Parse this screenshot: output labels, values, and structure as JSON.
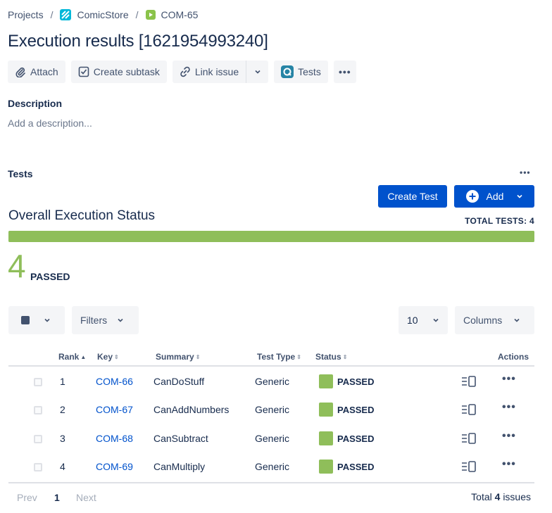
{
  "breadcrumb": {
    "projects": "Projects",
    "project": "ComicStore",
    "issue": "COM-65"
  },
  "title": "Execution results [1621954993240]",
  "toolbar": {
    "attach": "Attach",
    "create_subtask": "Create subtask",
    "link_issue": "Link issue",
    "tests": "Tests"
  },
  "description": {
    "label": "Description",
    "placeholder": "Add a description..."
  },
  "tests_section": {
    "label": "Tests",
    "create_test": "Create Test",
    "add": "Add",
    "overall_title": "Overall Execution Status",
    "total_tests": "TOTAL TESTS: 4",
    "passed_count": "4",
    "passed_label": "PASSED",
    "passed_fraction": 1.0
  },
  "controls": {
    "filters": "Filters",
    "page_size": "10",
    "columns": "Columns"
  },
  "table": {
    "headers": {
      "rank": "Rank",
      "key": "Key",
      "summary": "Summary",
      "test_type": "Test Type",
      "status": "Status",
      "actions": "Actions"
    },
    "rows": [
      {
        "rank": "1",
        "key": "COM-66",
        "summary": "CanDoStuff",
        "test_type": "Generic",
        "status": "PASSED"
      },
      {
        "rank": "2",
        "key": "COM-67",
        "summary": "CanAddNumbers",
        "test_type": "Generic",
        "status": "PASSED"
      },
      {
        "rank": "3",
        "key": "COM-68",
        "summary": "CanSubtract",
        "test_type": "Generic",
        "status": "PASSED"
      },
      {
        "rank": "4",
        "key": "COM-69",
        "summary": "CanMultiply",
        "test_type": "Generic",
        "status": "PASSED"
      }
    ]
  },
  "pagination": {
    "prev": "Prev",
    "current": "1",
    "next": "Next",
    "total_prefix": "Total",
    "total_count": "4",
    "total_suffix": "issues"
  },
  "colors": {
    "passed": "#8fbe5a",
    "primary": "#0052cc",
    "link": "#0052cc"
  },
  "icons": {
    "project": "comicstore-project-icon",
    "story": "story-icon"
  }
}
